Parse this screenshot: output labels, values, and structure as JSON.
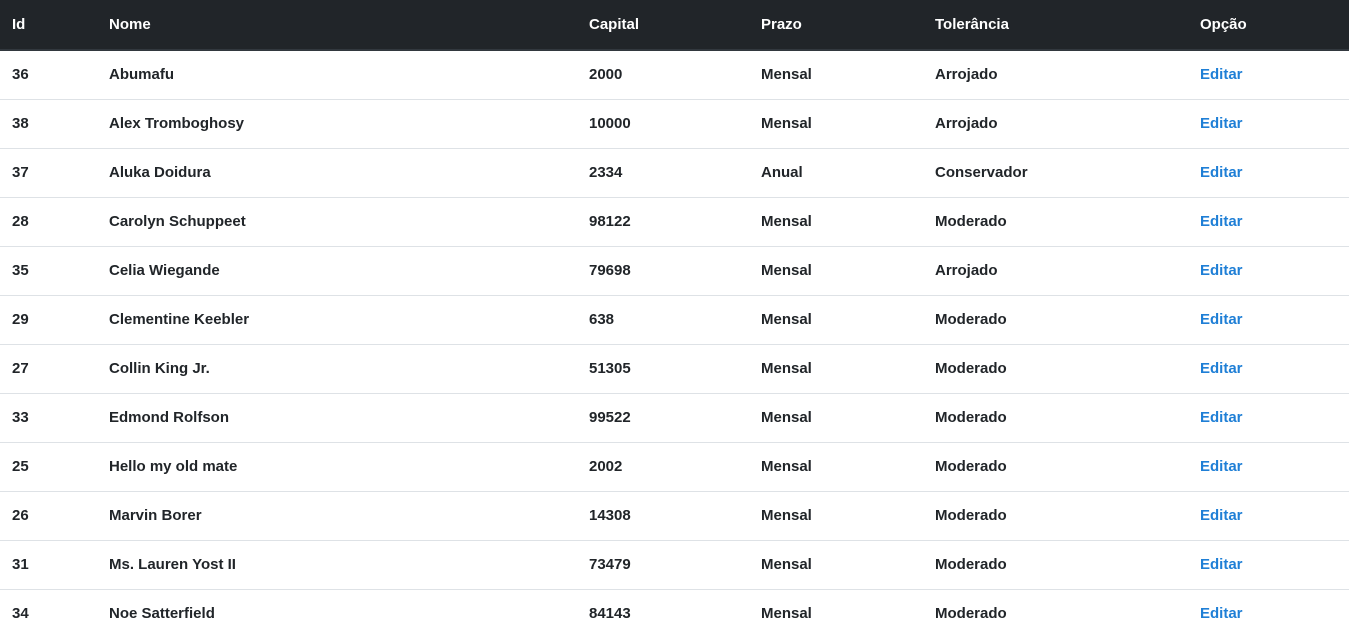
{
  "table": {
    "headers": {
      "id": "Id",
      "nome": "Nome",
      "capital": "Capital",
      "prazo": "Prazo",
      "tolerancia": "Tolerância",
      "opcao": "Opção"
    },
    "rows": [
      {
        "id": "36",
        "nome": "Abumafu",
        "capital": "2000",
        "prazo": "Mensal",
        "tolerancia": "Arrojado",
        "action": "Editar"
      },
      {
        "id": "38",
        "nome": "Alex Tromboghosy",
        "capital": "10000",
        "prazo": "Mensal",
        "tolerancia": "Arrojado",
        "action": "Editar"
      },
      {
        "id": "37",
        "nome": "Aluka Doidura",
        "capital": "2334",
        "prazo": "Anual",
        "tolerancia": "Conservador",
        "action": "Editar"
      },
      {
        "id": "28",
        "nome": "Carolyn Schuppeet",
        "capital": "98122",
        "prazo": "Mensal",
        "tolerancia": "Moderado",
        "action": "Editar"
      },
      {
        "id": "35",
        "nome": "Celia Wiegande",
        "capital": "79698",
        "prazo": "Mensal",
        "tolerancia": "Arrojado",
        "action": "Editar"
      },
      {
        "id": "29",
        "nome": "Clementine Keebler",
        "capital": "638",
        "prazo": "Mensal",
        "tolerancia": "Moderado",
        "action": "Editar"
      },
      {
        "id": "27",
        "nome": "Collin King Jr.",
        "capital": "51305",
        "prazo": "Mensal",
        "tolerancia": "Moderado",
        "action": "Editar"
      },
      {
        "id": "33",
        "nome": "Edmond Rolfson",
        "capital": "99522",
        "prazo": "Mensal",
        "tolerancia": "Moderado",
        "action": "Editar"
      },
      {
        "id": "25",
        "nome": "Hello my old mate",
        "capital": "2002",
        "prazo": "Mensal",
        "tolerancia": "Moderado",
        "action": "Editar"
      },
      {
        "id": "26",
        "nome": "Marvin Borer",
        "capital": "14308",
        "prazo": "Mensal",
        "tolerancia": "Moderado",
        "action": "Editar"
      },
      {
        "id": "31",
        "nome": "Ms. Lauren Yost II",
        "capital": "73479",
        "prazo": "Mensal",
        "tolerancia": "Moderado",
        "action": "Editar"
      },
      {
        "id": "34",
        "nome": "Noe Satterfield",
        "capital": "84143",
        "prazo": "Mensal",
        "tolerancia": "Moderado",
        "action": "Editar"
      }
    ]
  },
  "colors": {
    "header_bg": "#212529",
    "link": "#1f7fd6",
    "text": "#212529"
  }
}
